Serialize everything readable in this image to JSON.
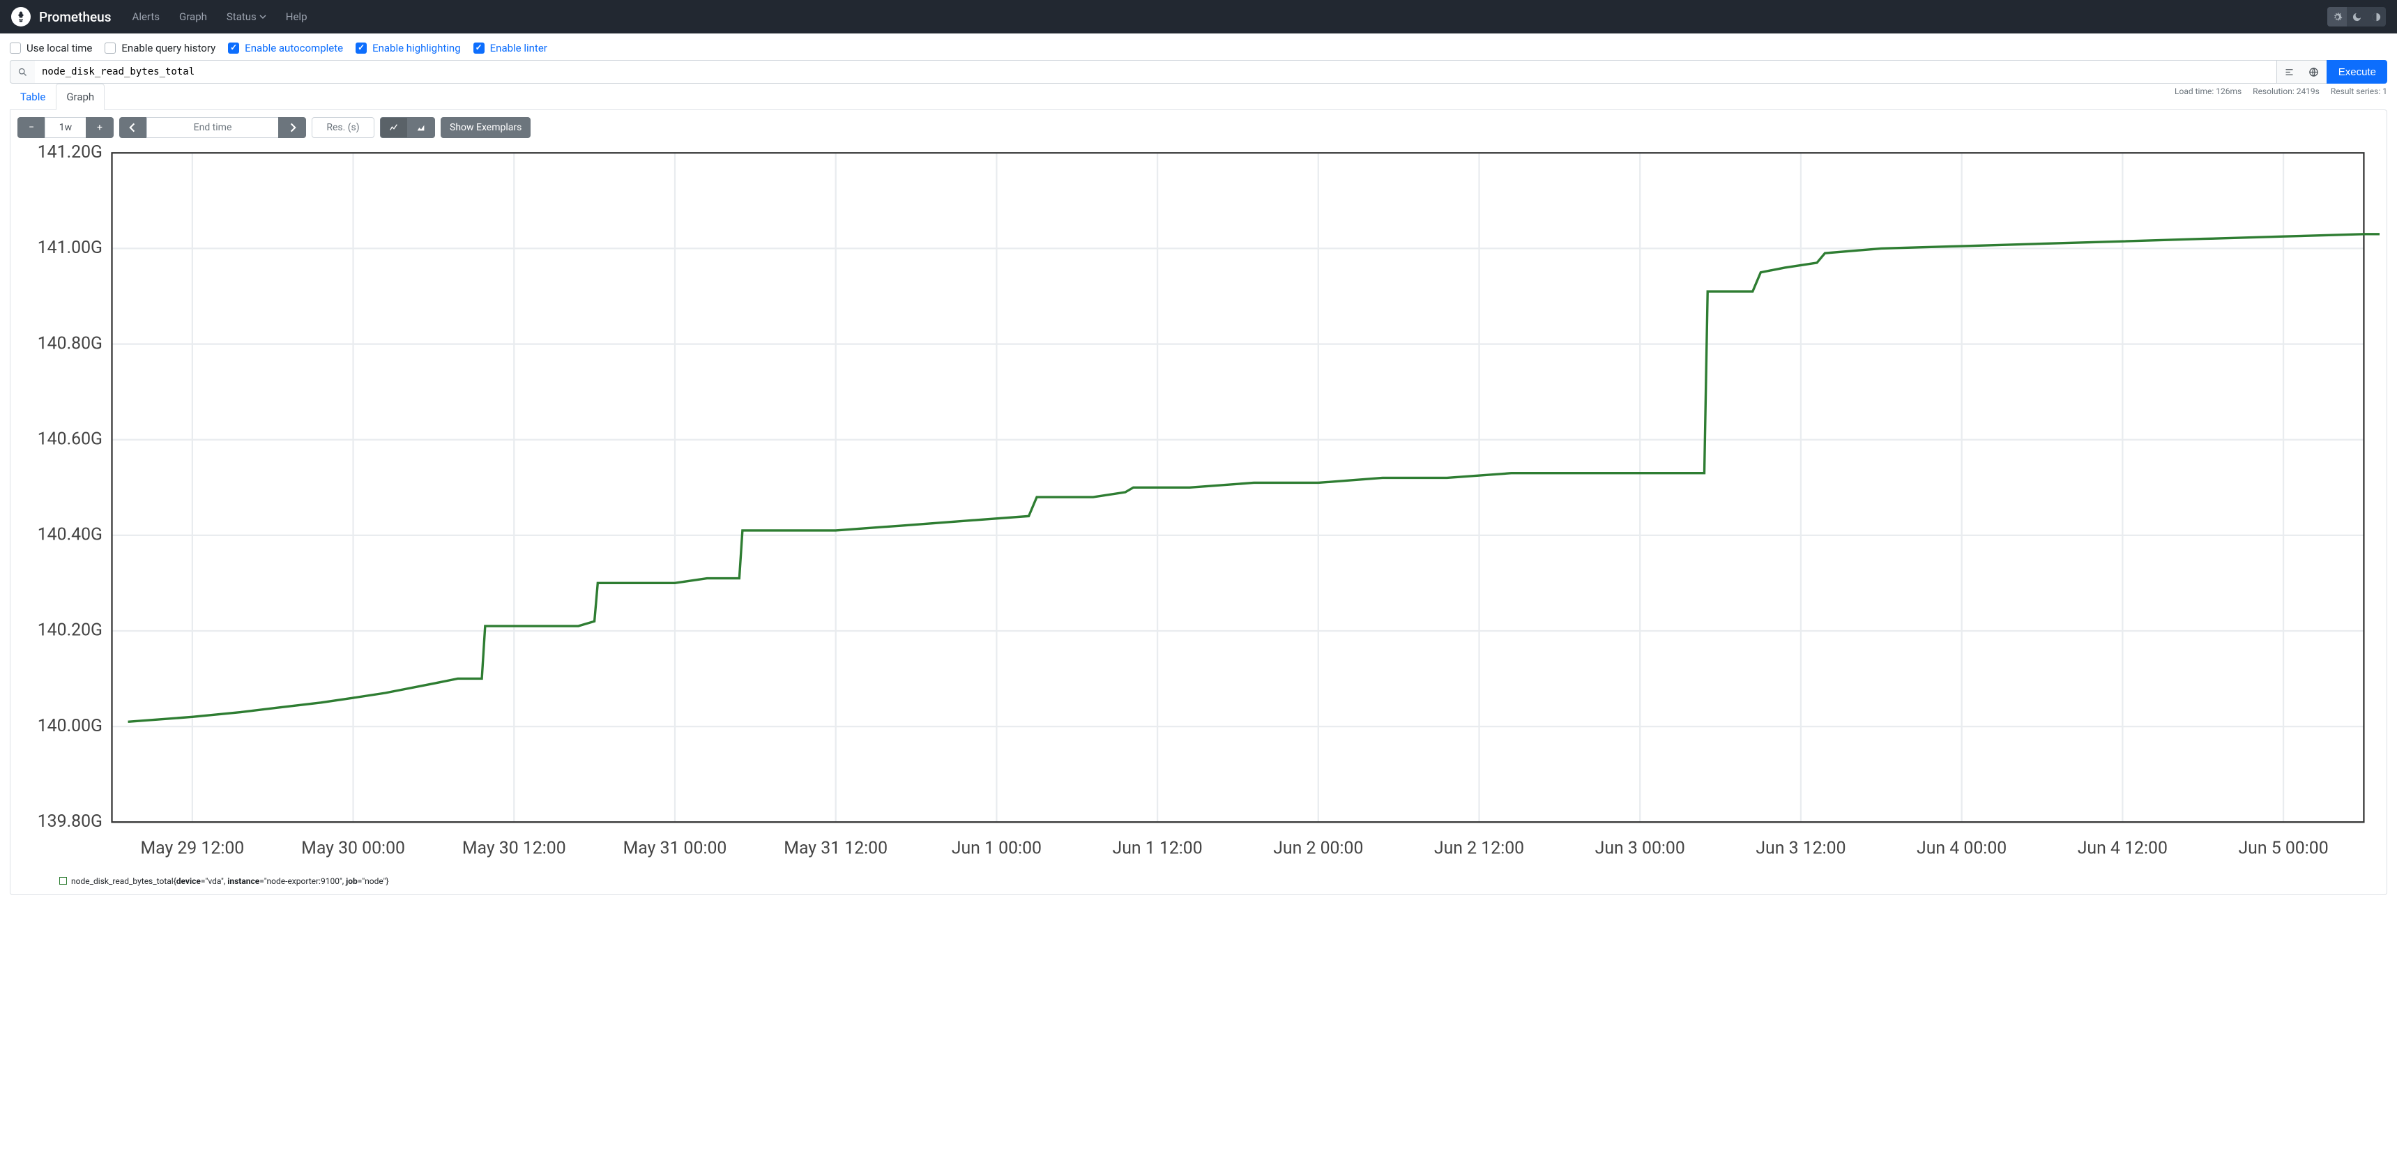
{
  "nav": {
    "brand": "Prometheus",
    "links": {
      "alerts": "Alerts",
      "graph": "Graph",
      "status": "Status",
      "help": "Help"
    }
  },
  "options": {
    "use_local_time": "Use local time",
    "enable_query_history": "Enable query history",
    "enable_autocomplete": "Enable autocomplete",
    "enable_highlighting": "Enable highlighting",
    "enable_linter": "Enable linter"
  },
  "query": {
    "expression": "node_disk_read_bytes_total",
    "execute_label": "Execute"
  },
  "stats": {
    "load_time": "Load time: 126ms",
    "resolution": "Resolution: 2419s",
    "result_series": "Result series: 1"
  },
  "tabs": {
    "table": "Table",
    "graph": "Graph"
  },
  "controls": {
    "range": "1w",
    "end_time_placeholder": "End time",
    "res_placeholder": "Res. (s)",
    "show_exemplars": "Show Exemplars"
  },
  "chart_data": {
    "type": "line",
    "ylabel_suffix": "G",
    "ylim": [
      139.8,
      141.2
    ],
    "yticks": [
      139.8,
      140.0,
      140.2,
      140.4,
      140.6,
      140.8,
      141.0,
      141.2
    ],
    "xticks": [
      "May 29 12:00",
      "May 30 00:00",
      "May 30 12:00",
      "May 31 00:00",
      "May 31 12:00",
      "Jun 1 00:00",
      "Jun 1 12:00",
      "Jun 2 00:00",
      "Jun 2 12:00",
      "Jun 3 00:00",
      "Jun 3 12:00",
      "Jun 4 00:00",
      "Jun 4 12:00",
      "Jun 5 00:00"
    ],
    "x_range_ticks": 14,
    "series": [
      {
        "name": "node_disk_read_bytes_total",
        "labels": {
          "device": "vda",
          "instance": "node-exporter:9100",
          "job": "node"
        },
        "points": [
          [
            -0.4,
            140.01
          ],
          [
            0.0,
            140.02
          ],
          [
            0.3,
            140.03
          ],
          [
            0.55,
            140.04
          ],
          [
            0.8,
            140.05
          ],
          [
            1.0,
            140.06
          ],
          [
            1.2,
            140.07
          ],
          [
            1.5,
            140.09
          ],
          [
            1.65,
            140.1
          ],
          [
            1.8,
            140.1
          ],
          [
            1.82,
            140.21
          ],
          [
            2.4,
            140.21
          ],
          [
            2.5,
            140.22
          ],
          [
            2.52,
            140.3
          ],
          [
            3.0,
            140.3
          ],
          [
            3.2,
            140.31
          ],
          [
            3.4,
            140.31
          ],
          [
            3.42,
            140.41
          ],
          [
            4.0,
            140.41
          ],
          [
            4.4,
            140.42
          ],
          [
            4.8,
            140.43
          ],
          [
            5.2,
            140.44
          ],
          [
            5.25,
            140.48
          ],
          [
            5.6,
            140.48
          ],
          [
            5.8,
            140.49
          ],
          [
            5.85,
            140.5
          ],
          [
            6.2,
            140.5
          ],
          [
            6.6,
            140.51
          ],
          [
            7.0,
            140.51
          ],
          [
            7.4,
            140.52
          ],
          [
            7.8,
            140.52
          ],
          [
            8.2,
            140.53
          ],
          [
            8.6,
            140.53
          ],
          [
            9.0,
            140.53
          ],
          [
            9.4,
            140.53
          ],
          [
            9.42,
            140.91
          ],
          [
            9.7,
            140.91
          ],
          [
            9.75,
            140.95
          ],
          [
            9.9,
            140.96
          ],
          [
            10.1,
            140.97
          ],
          [
            10.15,
            140.99
          ],
          [
            10.5,
            141.0
          ],
          [
            11.0,
            141.005
          ],
          [
            11.5,
            141.01
          ],
          [
            12.0,
            141.015
          ],
          [
            12.5,
            141.02
          ],
          [
            13.0,
            141.025
          ],
          [
            13.5,
            141.03
          ],
          [
            13.9,
            141.03
          ]
        ]
      }
    ]
  },
  "legend_template": {
    "metric": "node_disk_read_bytes_total",
    "device_k": "device",
    "device_v": "\"vda\"",
    "instance_k": "instance",
    "instance_v": "\"node-exporter:9100\"",
    "job_k": "job",
    "job_v": "\"node\""
  }
}
